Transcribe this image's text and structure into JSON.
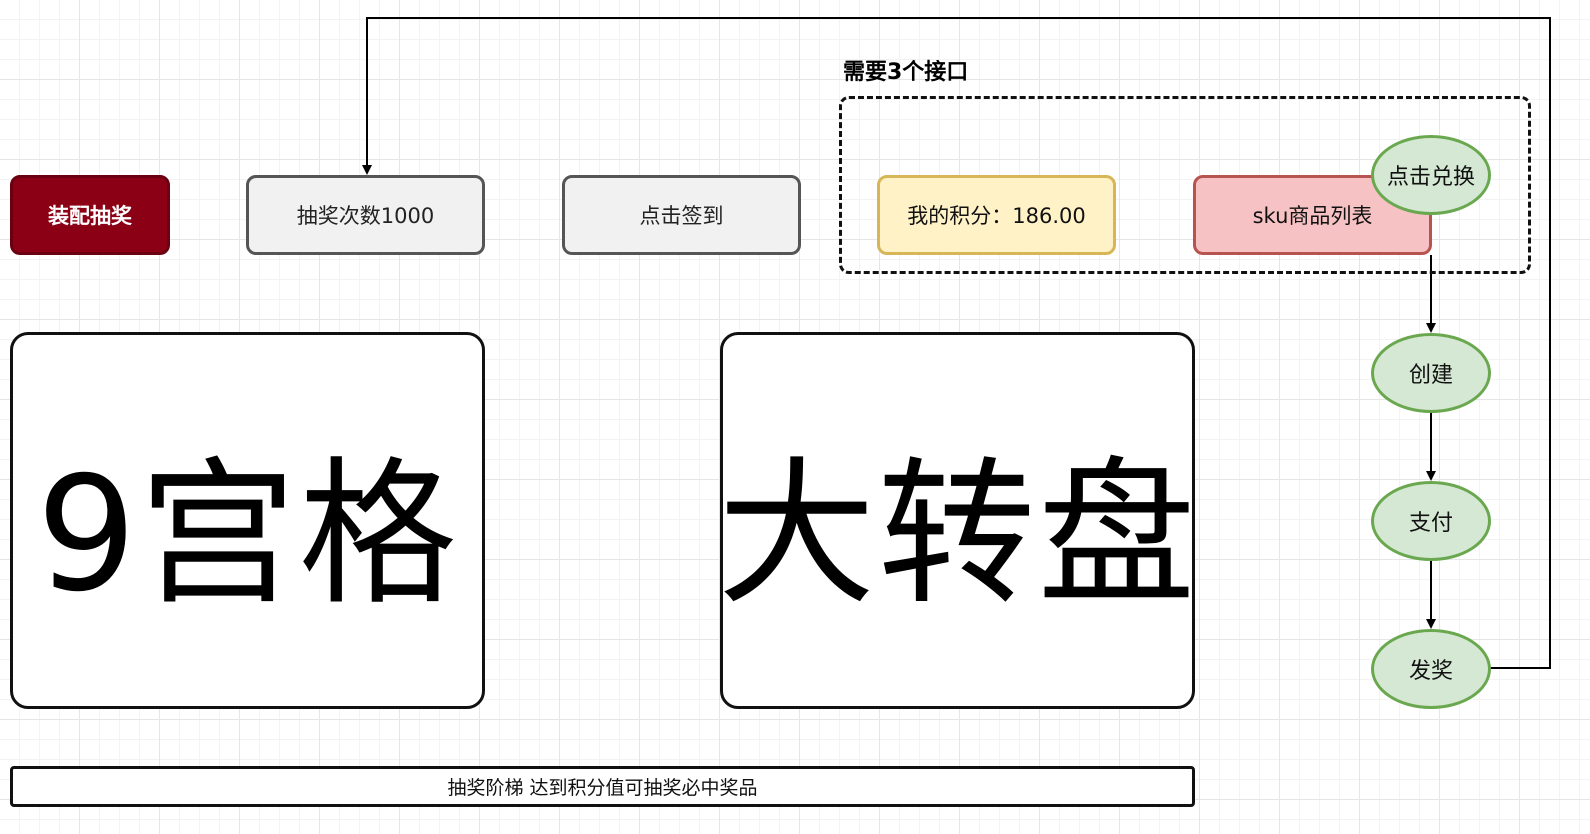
{
  "colors": {
    "primary_fill": "#8b0014",
    "neutral_fill": "#f1f1f1",
    "points_fill": "#fff2c7",
    "sku_fill": "#f6c2c4",
    "flow_fill": "#d5e8d4",
    "flow_border": "#6aa84f"
  },
  "top_row": {
    "assemble": "装配抽奖",
    "draw_count": "抽奖次数1000",
    "checkin": "点击签到",
    "points": "我的积分：186.00",
    "sku_list": "sku商品列表"
  },
  "group": {
    "label": "需要3个接口"
  },
  "panels": {
    "nine_grid": "9宫格",
    "wheel": "大转盘"
  },
  "ladder": {
    "text": "抽奖阶梯 达到积分值可抽奖必中奖品"
  },
  "flow": {
    "exchange": "点击兑换",
    "create": "创建",
    "pay": "支付",
    "award": "发奖"
  }
}
